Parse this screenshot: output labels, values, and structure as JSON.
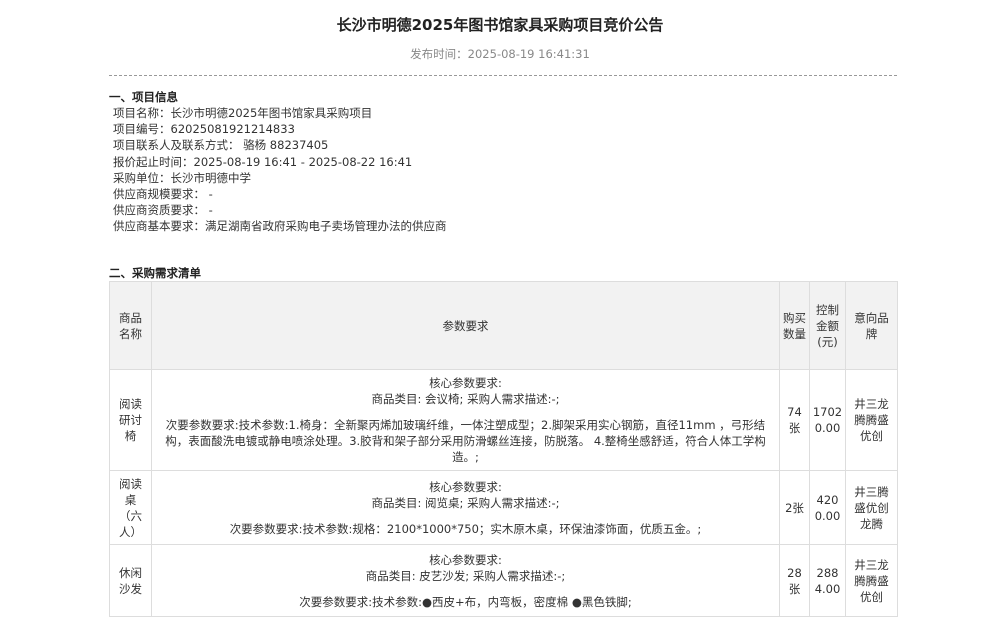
{
  "title": "长沙市明德2025年图书馆家具采购项目竞价公告",
  "publish_time": "发布时间：2025-08-19 16:41:31",
  "section1": {
    "heading": "一、项目信息",
    "lines": [
      "项目名称：长沙市明德2025年图书馆家具采购项目",
      "项目编号：62025081921214833",
      "项目联系人及联系方式： 骆杨  88237405",
      "报价起止时间：2025-08-19 16:41  -  2025-08-22 16:41",
      "采购单位：长沙市明德中学",
      "供应商规模要求： -",
      "供应商资质要求： -",
      "供应商基本要求：满足湖南省政府采购电子卖场管理办法的供应商"
    ]
  },
  "section2": {
    "heading": "二、采购需求清单",
    "headers": [
      "商品名称",
      "参数要求",
      "购买数量",
      "控制金额(元)",
      "意向品牌"
    ],
    "rows": [
      {
        "name": "阅读研讨椅",
        "core": "核心参数要求:",
        "category": "商品类目: 会议椅; 采购人需求描述:-;",
        "secondary": "次要参数要求:技术参数:1.椅身：全新聚丙烯加玻璃纤维，一体注塑成型；2.脚架采用实心钢筋，直径11mm ，弓形结构，表面酸洗电镀或静电喷涂处理。3.胶背和架子部分采用防滑螺丝连接，防脱落。 4.整椅坐感舒适，符合人体工学构造。;",
        "qty": "74张",
        "amount": "17020.00",
        "brand": "井三龙腾腾盛优创"
      },
      {
        "name": "阅读桌（六人）",
        "core": "核心参数要求:",
        "category": "商品类目: 阅览桌; 采购人需求描述:-;",
        "secondary": "次要参数要求:技术参数:规格：2100*1000*750；实木原木桌，环保油漆饰面，优质五金。;",
        "qty": "2张",
        "amount": "4200.00",
        "brand": "井三腾盛优创龙腾"
      },
      {
        "name": "休闲沙发",
        "core": "核心参数要求:",
        "category": "商品类目: 皮艺沙发; 采购人需求描述:-;",
        "secondary": "次要参数要求:技术参数:●西皮+布，内弯板，密度棉 ●黑色铁脚;",
        "qty": "28张",
        "amount": "2884.00",
        "brand": "井三龙腾腾盛优创"
      }
    ]
  }
}
